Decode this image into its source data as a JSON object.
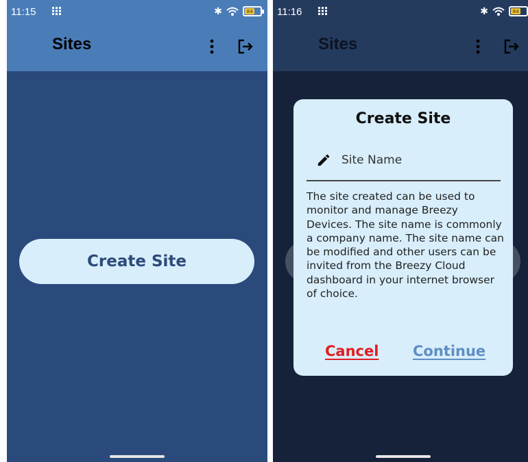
{
  "left_screen": {
    "status": {
      "time": "11:15"
    },
    "appbar": {
      "title": "Sites"
    },
    "create_button_label": "Create Site"
  },
  "right_screen": {
    "status": {
      "time": "11:16"
    },
    "appbar": {
      "title": "Sites"
    },
    "dialog": {
      "title": "Create Site",
      "site_name_placeholder": "Site Name",
      "description": "The site created can be used to monitor and manage Breezy Devices. The site name is commonly a company name. The site name can be modified and other users can be invited from the Breezy Cloud dashboard in your internet browser of choice.",
      "cancel_label": "Cancel",
      "continue_label": "Continue"
    }
  },
  "status_icons": {
    "bluetooth": "bluetooth-icon",
    "wifi": "wifi-icon",
    "battery": "battery-icon",
    "battery_level": "84"
  },
  "icons": {
    "grid": "grid-icon",
    "more": "more-vert-icon",
    "logout": "logout-icon",
    "pencil": "pencil-icon"
  },
  "colors": {
    "appbar_left": "#4a7db8",
    "background_left": "#2b4a7c",
    "appbar_right": "#253b5e",
    "background_right": "#16213a",
    "button_bg": "#d8eefb",
    "button_text": "#2d4a7a",
    "cancel": "#e11d21",
    "continue": "#5e8ec2"
  }
}
